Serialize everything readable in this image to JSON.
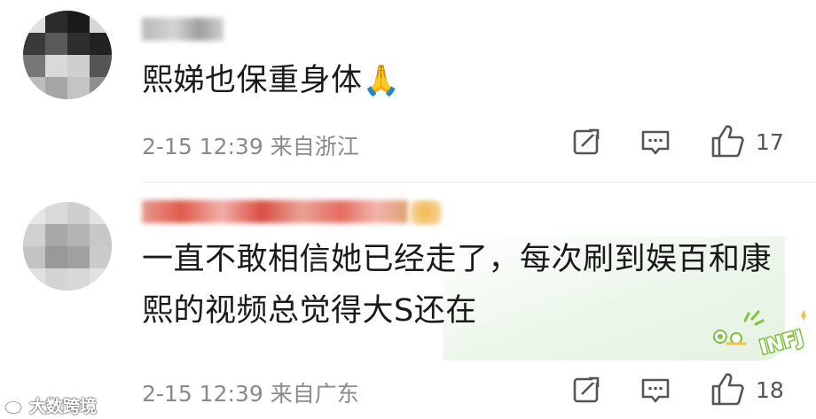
{
  "comments": [
    {
      "text": "熙娣也保重身体",
      "emoji": "🙏",
      "time": "2-15 12:39",
      "location": "来自浙江",
      "likes": "17"
    },
    {
      "text_line1": "一直不敢相信她已经走了，每次刷到娱百和康",
      "text_line2": "熙的视频总觉得大S还在",
      "time": "2-15 12:39",
      "location": "来自广东",
      "likes": "18",
      "sticker_text": "INFJ"
    }
  ],
  "watermark": "大数跨境",
  "colors": {
    "meta": "#8a8a8a",
    "text": "#1a1a1a",
    "sticker_green": "#7fc241"
  },
  "icons": [
    "share-icon",
    "comment-icon",
    "like-icon",
    "pray-emoji",
    "weibo-logo-icon"
  ]
}
